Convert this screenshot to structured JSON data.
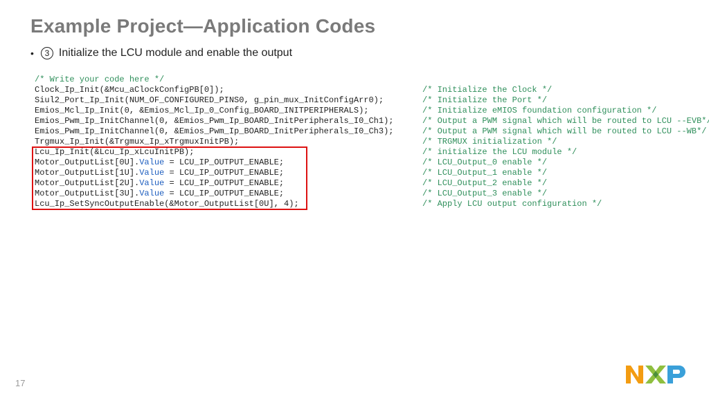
{
  "title": "Example Project—Application Codes",
  "step": {
    "num": "3",
    "text": "Initialize the LCU module and enable the output"
  },
  "lines": [
    {
      "kind": "cmt",
      "code": "/* Write your code here */"
    },
    {
      "kind": "pair",
      "code": "Clock_Ip_Init(&Mcu_aClockConfigPB[0]);",
      "comment": "/* Initialize the Clock */"
    },
    {
      "kind": "pair",
      "code": "Siul2_Port_Ip_Init(NUM_OF_CONFIGURED_PINS0, g_pin_mux_InitConfigArr0);",
      "comment": "/* Initialize the Port */"
    },
    {
      "kind": "pair",
      "code": "Emios_Mcl_Ip_Init(0, &Emios_Mcl_Ip_0_Config_BOARD_INITPERIPHERALS);",
      "comment": "/* Initialize eMIOS foundation configuration */"
    },
    {
      "kind": "pair",
      "code": "Emios_Pwm_Ip_InitChannel(0, &Emios_Pwm_Ip_BOARD_InitPeripherals_I0_Ch1);",
      "comment": "/* Output a PWM signal which will be routed to LCU --EVB*/"
    },
    {
      "kind": "pair",
      "code": "Emios_Pwm_Ip_InitChannel(0, &Emios_Pwm_Ip_BOARD_InitPeripherals_I0_Ch3);",
      "comment": "/* Output a PWM signal which will be routed to LCU --WB*/"
    },
    {
      "kind": "pair",
      "code": "Trgmux_Ip_Init(&Trgmux_Ip_xTrgmuxInitPB);",
      "comment": "/* TRGMUX initialization */"
    },
    {
      "kind": "pair",
      "code": "Lcu_Ip_Init(&Lcu_Ip_xLcuInitPB);",
      "comment": "/* initialize the LCU module */"
    },
    {
      "kind": "val",
      "pre": "Motor_OutputList[0U].",
      "val": "Value",
      "post": " = LCU_IP_OUTPUT_ENABLE;",
      "comment": "/* LCU_Output_0 enable */"
    },
    {
      "kind": "val",
      "pre": "Motor_OutputList[1U].",
      "val": "Value",
      "post": " = LCU_IP_OUTPUT_ENABLE;",
      "comment": "/* LCU_Output_1 enable */"
    },
    {
      "kind": "val",
      "pre": "Motor_OutputList[2U].",
      "val": "Value",
      "post": " = LCU_IP_OUTPUT_ENABLE;",
      "comment": "/* LCU_Output_2 enable */"
    },
    {
      "kind": "val",
      "pre": "Motor_OutputList[3U].",
      "val": "Value",
      "post": " = LCU_IP_OUTPUT_ENABLE;",
      "comment": "/* LCU_Output_3 enable */"
    },
    {
      "kind": "pair",
      "code": "Lcu_Ip_SetSyncOutputEnable(&Motor_OutputList[0U], 4);",
      "comment": "/* Apply LCU output configuration */"
    }
  ],
  "highlight": {
    "startLine": 7,
    "endLine": 12,
    "overCodeOnly": true
  },
  "pageNumber": "17"
}
